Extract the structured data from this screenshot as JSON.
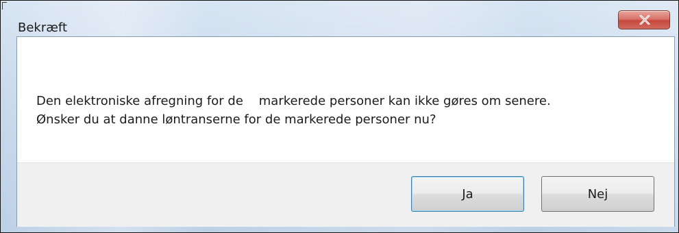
{
  "dialog": {
    "title": "Bekræft",
    "message_line1": "Den elektroniske afregning for de    markerede personer kan ikke gøres om senere.",
    "message_line2": "Ønsker du at danne løntranserne for de markerede personer nu?",
    "buttons": {
      "yes_label": "Ja",
      "no_label": "Nej"
    },
    "close_icon": "close-x-icon"
  },
  "colors": {
    "frame": "#c8d9ec",
    "close_button": "#c7483d",
    "footer": "#f0f0f0",
    "default_button_border": "#3c7fb1"
  }
}
